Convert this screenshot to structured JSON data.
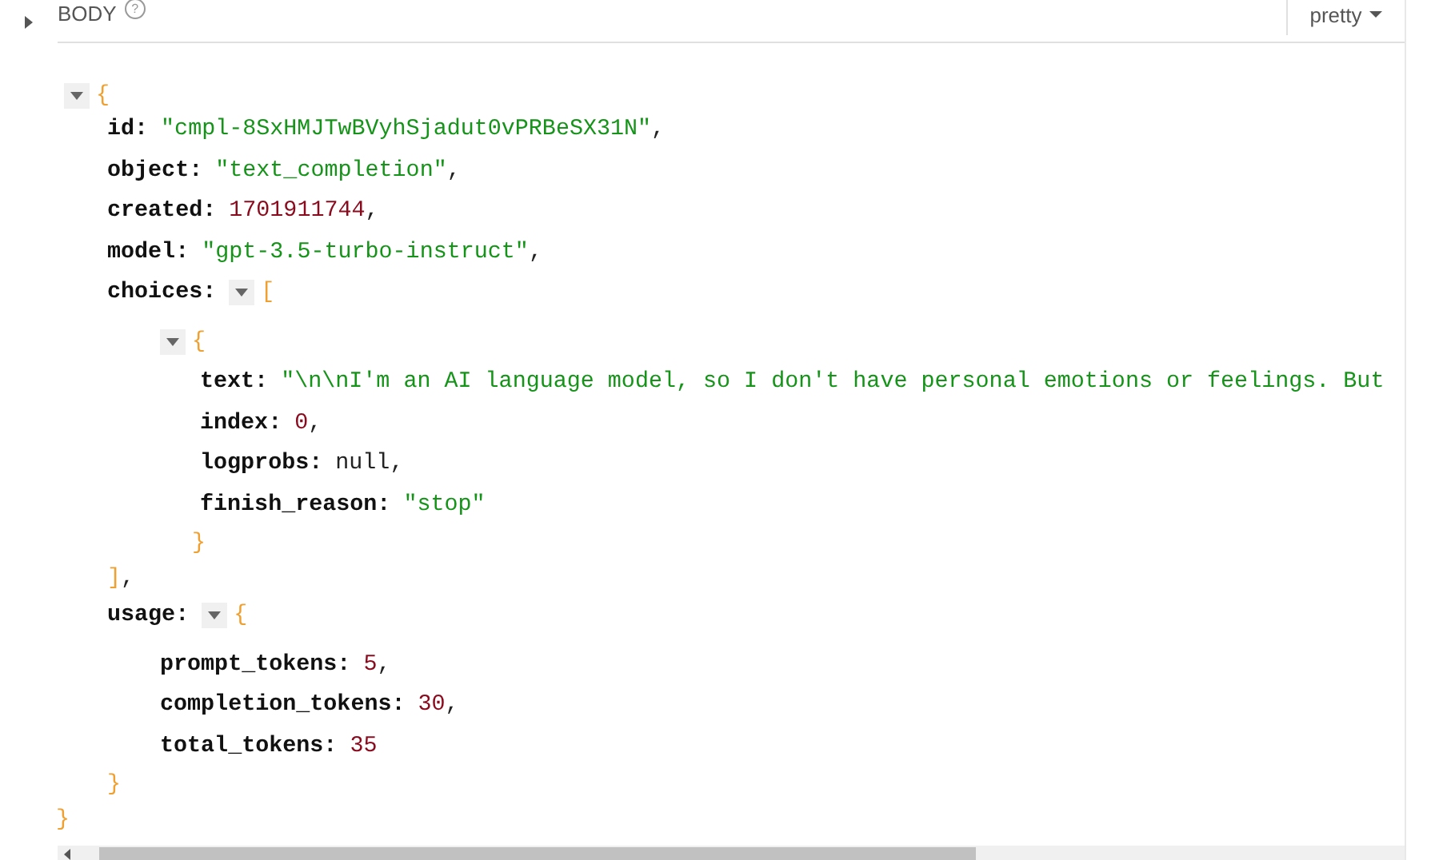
{
  "body_section": {
    "label": "BODY",
    "help": "?",
    "expanded": false,
    "format": "pretty"
  },
  "response": {
    "kind": "object",
    "expanded": true,
    "open": "{",
    "close": "}",
    "children": [
      {
        "key": "id:",
        "kind": "string",
        "value": "\"cmpl-8SxHMJTwBVyhSjadut0vPRBeSX31N\"",
        "suffix": ","
      },
      {
        "key": "object:",
        "kind": "string",
        "value": "\"text_completion\"",
        "suffix": ","
      },
      {
        "key": "created:",
        "kind": "number",
        "value": "1701911744",
        "suffix": ","
      },
      {
        "key": "model:",
        "kind": "string",
        "value": "\"gpt-3.5-turbo-instruct\"",
        "suffix": ","
      },
      {
        "key": "choices:",
        "kind": "array",
        "expanded": true,
        "open": "[",
        "close": "]",
        "close_suffix": ",",
        "children": [
          {
            "kind": "object",
            "expanded": true,
            "open": "{",
            "close": "}",
            "children": [
              {
                "key": "text:",
                "kind": "string",
                "value": "\"\\n\\nI'm an AI language model, so I don't have personal emotions or feelings. But"
              },
              {
                "key": "index:",
                "kind": "number",
                "value": "0",
                "suffix": ","
              },
              {
                "key": "logprobs:",
                "kind": "null",
                "value": "null",
                "suffix": ","
              },
              {
                "key": "finish_reason:",
                "kind": "string",
                "value": "\"stop\""
              }
            ]
          }
        ]
      },
      {
        "key": "usage:",
        "kind": "object",
        "expanded": true,
        "open": "{",
        "close": "}",
        "children": [
          {
            "key": "prompt_tokens:",
            "kind": "number",
            "value": "5",
            "suffix": ","
          },
          {
            "key": "completion_tokens:",
            "kind": "number",
            "value": "30",
            "suffix": ","
          },
          {
            "key": "total_tokens:",
            "kind": "number",
            "value": "35"
          }
        ]
      }
    ]
  }
}
